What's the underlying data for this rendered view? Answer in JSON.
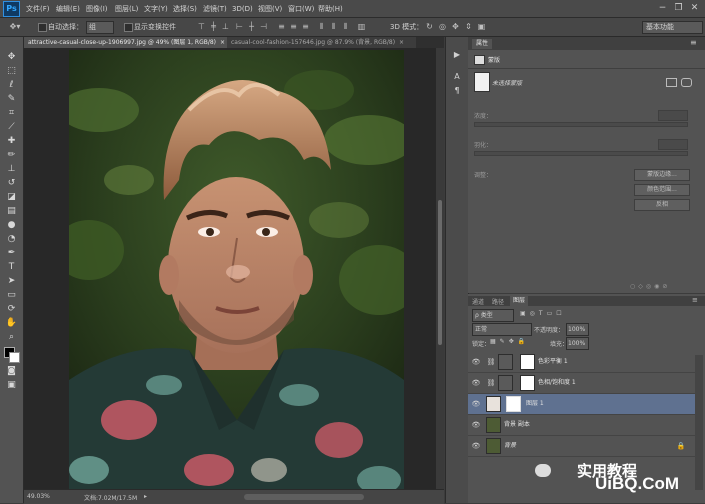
{
  "app": {
    "logo": "Ps"
  },
  "menu": [
    "文件(F)",
    "编辑(E)",
    "图像(I)",
    "图层(L)",
    "文字(Y)",
    "选择(S)",
    "滤镜(T)",
    "3D(D)",
    "视图(V)",
    "窗口(W)",
    "帮助(H)"
  ],
  "window_controls": {
    "minimize": "−",
    "restore": "❐",
    "close": "✕"
  },
  "options": {
    "auto_select_label": "自动选择：",
    "auto_select_value": "组",
    "show_transform_label": "显示变换控件",
    "mode_3d_label": "3D 模式：",
    "workspace": "基本功能"
  },
  "tabs": [
    {
      "label": "attractive-casual-close-up-1906997.jpg @ 49% (图层 1, RGB/8)",
      "close": "×",
      "active": true
    },
    {
      "label": "casual-cool-fashion-157646.jpg @ 87.9% (背景, RGB/8)",
      "close": "×",
      "active": false
    }
  ],
  "status": {
    "zoom": "49.03%",
    "doc": "文档:7.02M/17.5M"
  },
  "properties": {
    "tab": "属性",
    "sub": "蒙版",
    "mask_label": "未选择蒙版",
    "density_label": "浓度：",
    "feather_label": "羽化：",
    "adjust_label": "调整：",
    "btn_edge": "蒙版边缘...",
    "btn_color_range": "颜色范围...",
    "btn_invert": "反相"
  },
  "layers_panel": {
    "tabs": [
      "通道",
      "路径",
      "图层"
    ],
    "kind": "ρ 类型",
    "blend": "正常",
    "opacity_label": "不透明度：",
    "opacity": "100%",
    "lock_label": "锁定：",
    "fill_label": "填充：",
    "fill": "100%",
    "layers": [
      {
        "name": "色彩平衡 1",
        "type": "adjustment"
      },
      {
        "name": "色相/饱和度 1",
        "type": "adjustment"
      },
      {
        "name": "图层 1",
        "type": "masked",
        "selected": true
      },
      {
        "name": "背景 副本",
        "type": "photo"
      },
      {
        "name": "背景",
        "type": "photo",
        "locked": true
      }
    ]
  },
  "watermark": {
    "wechat": "实用教程",
    "site": "UiBQ.CoM"
  },
  "colors": {
    "accent": "#31a8ff",
    "selected_row": "#5f7190",
    "panel": "#535353"
  }
}
